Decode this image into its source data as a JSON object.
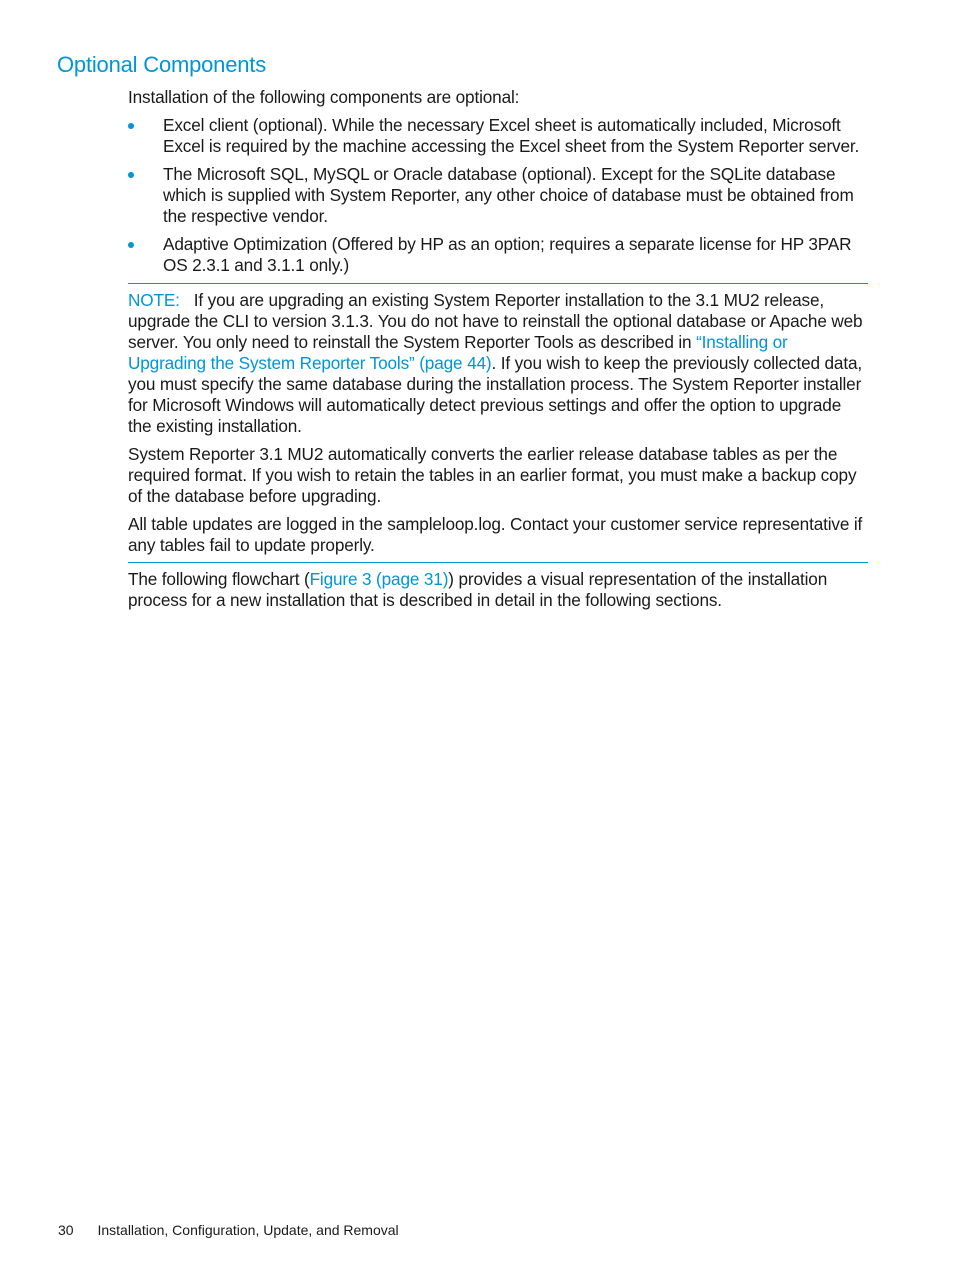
{
  "section": {
    "title": "Optional Components",
    "intro": "Installation of the following components are optional:",
    "bullets": [
      "Excel client (optional). While the necessary Excel sheet is automatically included, Microsoft Excel is required by the machine accessing the Excel sheet from the System Reporter server.",
      "The Microsoft SQL, MySQL or Oracle database (optional). Except for the SQLite database which is supplied with System Reporter, any other choice of database must be obtained from the respective vendor.",
      "Adaptive Optimization (Offered by HP as an option; requires a separate license for HP 3PAR OS 2.3.1 and 3.1.1 only.)"
    ]
  },
  "note": {
    "label": "NOTE:",
    "p1_text_a": "If you are upgrading an existing System Reporter installation to the 3.1 MU2 release, upgrade the CLI to version 3.1.3. You do not have to reinstall the optional database or Apache web server. You only need to reinstall the System Reporter Tools as described in ",
    "p1_link": "“Installing or Upgrading the System Reporter Tools” (page 44)",
    "p1_text_b": ". If you wish to keep the previously collected data, you must specify the same database during the installation process. The System Reporter installer for Microsoft Windows will automatically detect previous settings and offer the option to upgrade the existing installation.",
    "p2": "System Reporter 3.1 MU2 automatically converts the earlier release database tables as per the required format. If you wish to retain the tables in an earlier format, you must make a backup copy of the database before upgrading.",
    "p3": "All table updates are logged in the sampleloop.log. Contact your customer service representative if any tables fail to update properly."
  },
  "flowchart_para": {
    "text_a": "The following flowchart (",
    "link": "Figure 3 (page 31)",
    "text_b": ") provides a visual representation of the installation process for a new installation that is described in detail in the following sections."
  },
  "footer": {
    "page_number": "30",
    "chapter": "Installation, Configuration, Update, and Removal"
  },
  "colors": {
    "accent": "#0096d6",
    "text": "#1a1a1a"
  }
}
